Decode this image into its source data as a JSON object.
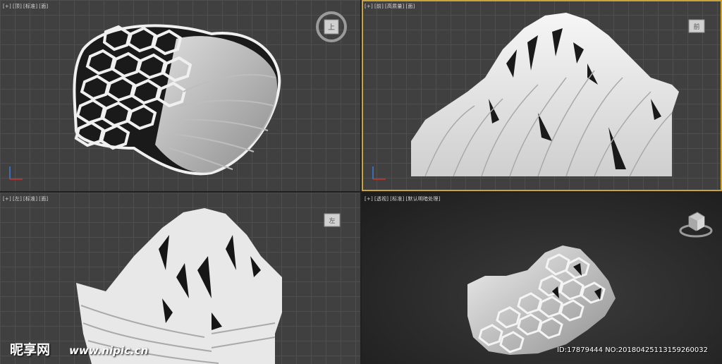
{
  "viewports": {
    "top": {
      "labels": [
        "[+]",
        "[顶]",
        "[标准]",
        "[面]"
      ],
      "cube_label": "上"
    },
    "front": {
      "labels": [
        "[+]",
        "[前]",
        "[高质量]",
        "[面]"
      ],
      "cube_label": "前"
    },
    "left": {
      "labels": [
        "[+]",
        "[左]",
        "[标准]",
        "[面]"
      ],
      "cube_label": "左"
    },
    "perspective": {
      "labels": [
        "[+]",
        "[透视]",
        "[标准]",
        "[默认明暗处理]"
      ]
    }
  },
  "watermark": {
    "logo": "昵享网",
    "url": "www.nipic.cn",
    "id_text": "ID:17879444 NO:20180425113159260032"
  },
  "colors": {
    "viewport_bg": "#404040",
    "grid_line": "#4e4e4e",
    "active_border": "#c8a43a",
    "model": "#e6e6e6"
  }
}
